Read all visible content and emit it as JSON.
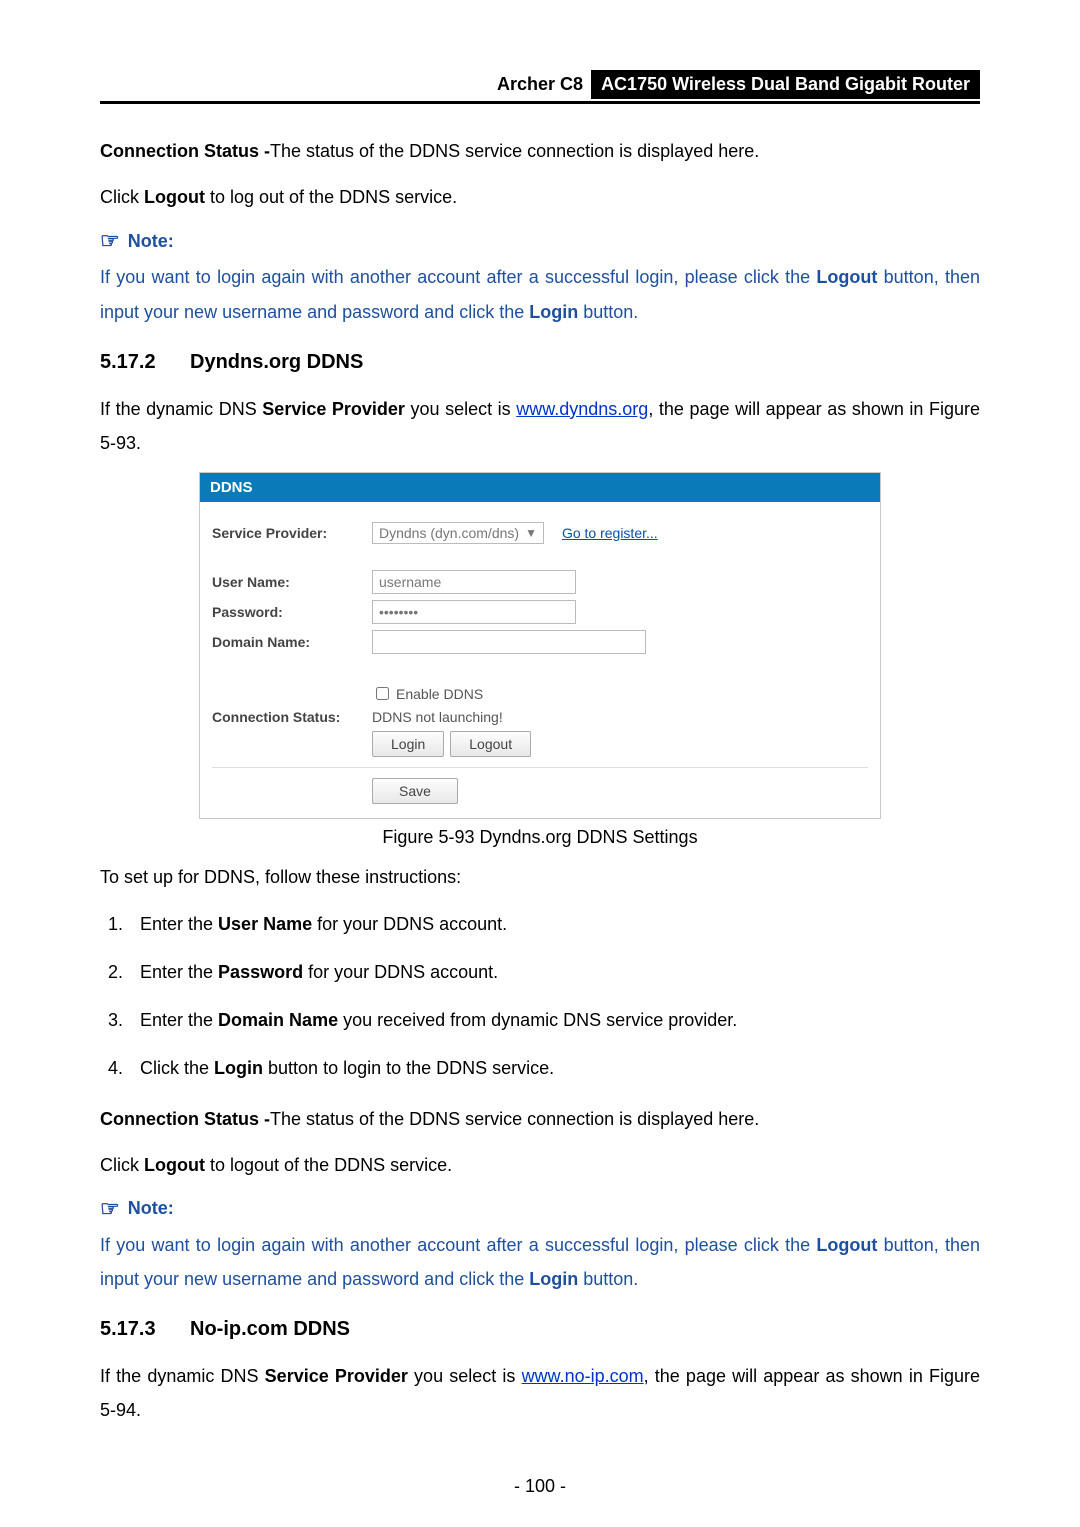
{
  "header": {
    "model": "Archer C8",
    "product": "AC1750 Wireless Dual Band Gigabit Router"
  },
  "p_connstatus_label": "Connection Status -",
  "p_connstatus_text": "The status of the DDNS service connection is displayed here.",
  "p_logout_pre": "Click ",
  "p_logout_bold": "Logout",
  "p_logout_post1": " to log out of the DDNS service.",
  "note_label": "Note:",
  "note1_a": "If you want to login again with another account after a successful login, please click the ",
  "note1_b": "Logout",
  "note1_c": " button, then input your new username and password and click the ",
  "note1_d": "Login",
  "note1_e": " button.",
  "sec1_num": "5.17.2",
  "sec1_title": "Dyndns.org DDNS",
  "sec1_p_a": "If the dynamic DNS ",
  "sec1_p_b": "Service Provider",
  "sec1_p_c": " you select is ",
  "sec1_p_link": "www.dyndns.org",
  "sec1_p_d": ", the page will appear as shown in Figure 5-93.",
  "panel": {
    "title": "DDNS",
    "labels": {
      "service_provider": "Service Provider:",
      "user_name": "User Name:",
      "password": "Password:",
      "domain_name": "Domain Name:",
      "conn_status": "Connection Status:"
    },
    "service_provider_value": "Dyndns (dyn.com/dns)",
    "register_link": "Go to register...",
    "username_value": "username",
    "password_value": "••••••••",
    "enable_label": "Enable DDNS",
    "conn_status_value": "DDNS not launching!",
    "login_btn": "Login",
    "logout_btn": "Logout",
    "save_btn": "Save"
  },
  "figcaption": "Figure 5-93 Dyndns.org DDNS Settings",
  "setup_intro": "To set up for DDNS, follow these instructions:",
  "step1_a": "Enter the ",
  "step1_b": "User Name",
  "step1_c": " for your DDNS account.",
  "step2_a": "Enter the ",
  "step2_b": "Password",
  "step2_c": " for your DDNS account.",
  "step3_a": "Enter the ",
  "step3_b": "Domain Name",
  "step3_c": " you received from dynamic DNS service provider.",
  "step4_a": "Click the ",
  "step4_b": "Login",
  "step4_c": " button to login to the DDNS service.",
  "p_logout2_post": " to logout of the DDNS service.",
  "sec2_num": "5.17.3",
  "sec2_title": "No-ip.com DDNS",
  "sec2_p_link": "www.no-ip.com",
  "sec2_p_d": ", the page will appear as shown in Figure 5-94.",
  "page_number": "- 100 -"
}
